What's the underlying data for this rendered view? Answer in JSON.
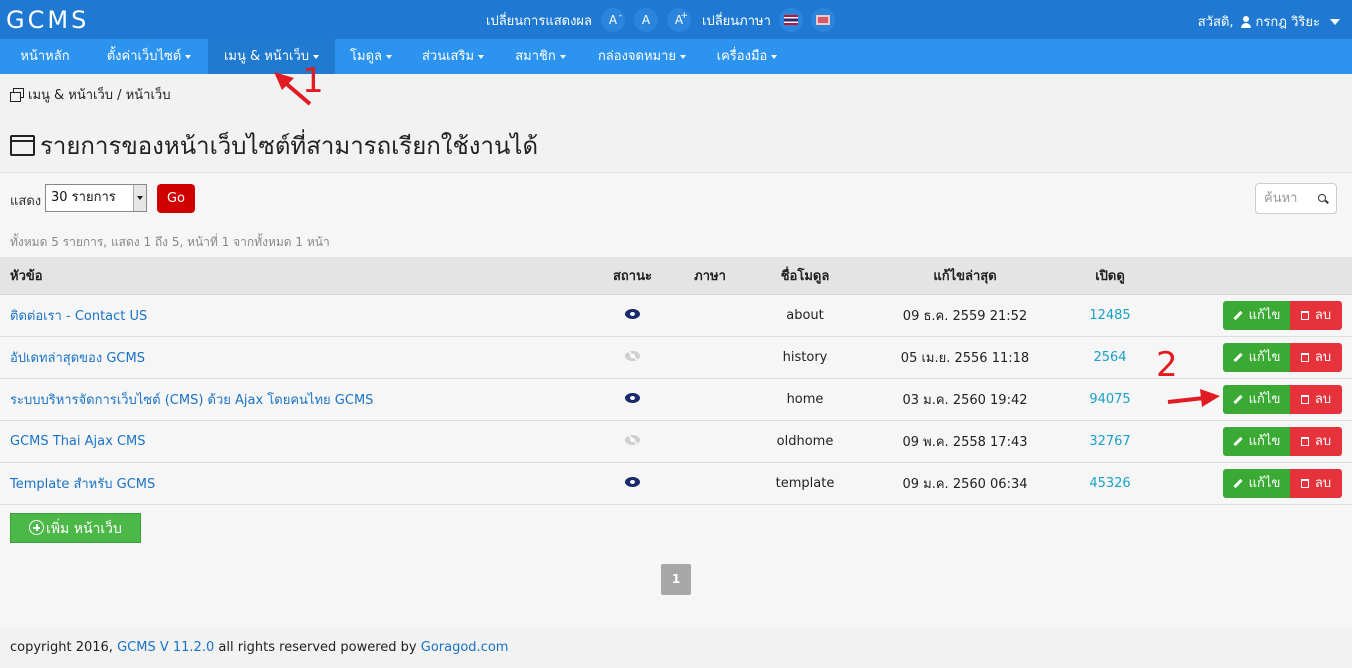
{
  "topbar": {
    "logo": "GCMS",
    "display_label": "เปลี่ยนการแสดงผล",
    "font_decrease": "A",
    "font_decrease_sup": "-",
    "font_normal": "A",
    "font_increase": "A",
    "font_increase_sup": "+",
    "language_label": "เปลี่ยนภาษา",
    "greeting": "สวัสดิ,",
    "user_name": "กรกฎ วิริยะ"
  },
  "menu": {
    "items": [
      {
        "label": "หน้าหลัก",
        "dropdown": false
      },
      {
        "label": "ตั้งค่าเว็บไซต์",
        "dropdown": true
      },
      {
        "label": "เมนู & หน้าเว็บ",
        "dropdown": true,
        "active": true
      },
      {
        "label": "โมดูล",
        "dropdown": true
      },
      {
        "label": "ส่วนเสริม",
        "dropdown": true
      },
      {
        "label": "สมาชิก",
        "dropdown": true
      },
      {
        "label": "กล่องจดหมาย",
        "dropdown": true
      },
      {
        "label": "เครื่องมือ",
        "dropdown": true
      }
    ]
  },
  "breadcrumb": {
    "path": "เมนู & หน้าเว็บ / หน้าเว็บ"
  },
  "page": {
    "title": "รายการของหน้าเว็บไซต์ที่สามารถเรียกใช้งานได้"
  },
  "filter": {
    "show_label": "แสดง",
    "per_page_value": "30 รายการ",
    "go_label": "Go",
    "search_placeholder": "ค้นหา"
  },
  "summary": "ทั้งหมด 5 รายการ, แสดง 1 ถึง 5, หน้าที่ 1 จากทั้งหมด 1 หน้า",
  "table": {
    "headers": {
      "title": "หัวข้อ",
      "status": "สถานะ",
      "language": "ภาษา",
      "module": "ชื่อโมดูล",
      "updated": "แก้ไขล่าสุด",
      "views": "เปิดดู"
    },
    "edit_label": "แก้ไข",
    "delete_label": "ลบ",
    "rows": [
      {
        "title": "ติดต่อเรา - Contact US",
        "published": true,
        "language": "",
        "module": "about",
        "updated": "09 ธ.ค. 2559 21:52",
        "views": "12485"
      },
      {
        "title": "อัปเดทล่าสุดของ GCMS",
        "published": false,
        "language": "",
        "module": "history",
        "updated": "05 เม.ย. 2556 11:18",
        "views": "2564"
      },
      {
        "title": "ระบบบริหารจัดการเว็บไซต์ (CMS) ด้วย Ajax โดยคนไทย GCMS",
        "published": true,
        "language": "",
        "module": "home",
        "updated": "03 ม.ค. 2560 19:42",
        "views": "94075"
      },
      {
        "title": "GCMS Thai Ajax CMS",
        "published": false,
        "language": "",
        "module": "oldhome",
        "updated": "09 พ.ค. 2558 17:43",
        "views": "32767"
      },
      {
        "title": "Template สำหรับ GCMS",
        "published": true,
        "language": "",
        "module": "template",
        "updated": "09 ม.ค. 2560 06:34",
        "views": "45326"
      }
    ]
  },
  "add_button": "เพิ่ม หน้าเว็บ",
  "pagination": {
    "current": "1"
  },
  "footer": {
    "prefix": "copyright 2016,",
    "product_link": "GCMS V 11.2.0",
    "middle": "all rights reserved powered by",
    "company_link": "Goragod.com"
  },
  "annotations": {
    "one": "1",
    "two": "2",
    "color": "#e01b22"
  },
  "colors": {
    "topbar": "#1f79d2",
    "menubar": "#2c94ee",
    "edit": "#3aaa35",
    "delete": "#e6323b",
    "go": "#d10000"
  }
}
